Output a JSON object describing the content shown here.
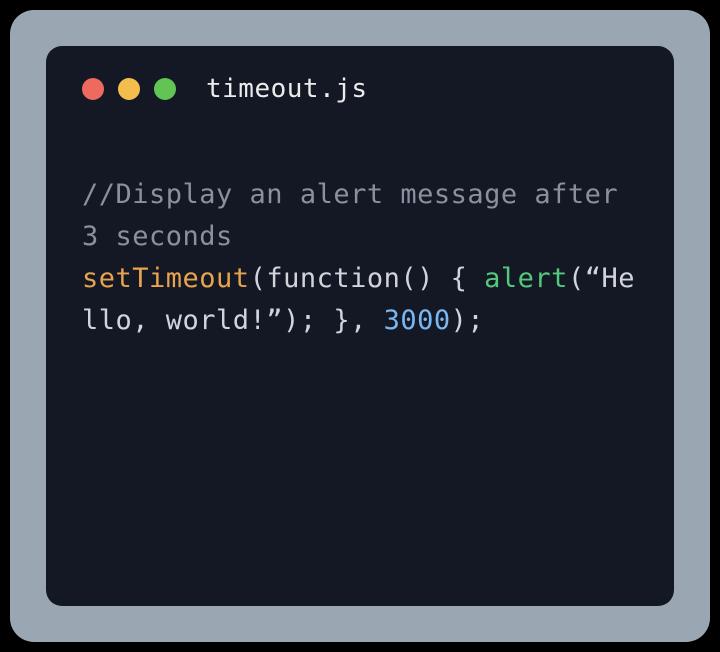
{
  "window": {
    "filename": "timeout.js"
  },
  "code": {
    "comment": " //Display an alert message after 3 seconds",
    "fn_settimeout": "setTimeout",
    "open1": "(",
    "keyword_function": "function",
    "parens_empty": "() { ",
    "fn_alert": "alert",
    "open2": "(",
    "string": "“Hello, world!”",
    "close2": "); }, ",
    "number": "3000",
    "close1": ");"
  }
}
